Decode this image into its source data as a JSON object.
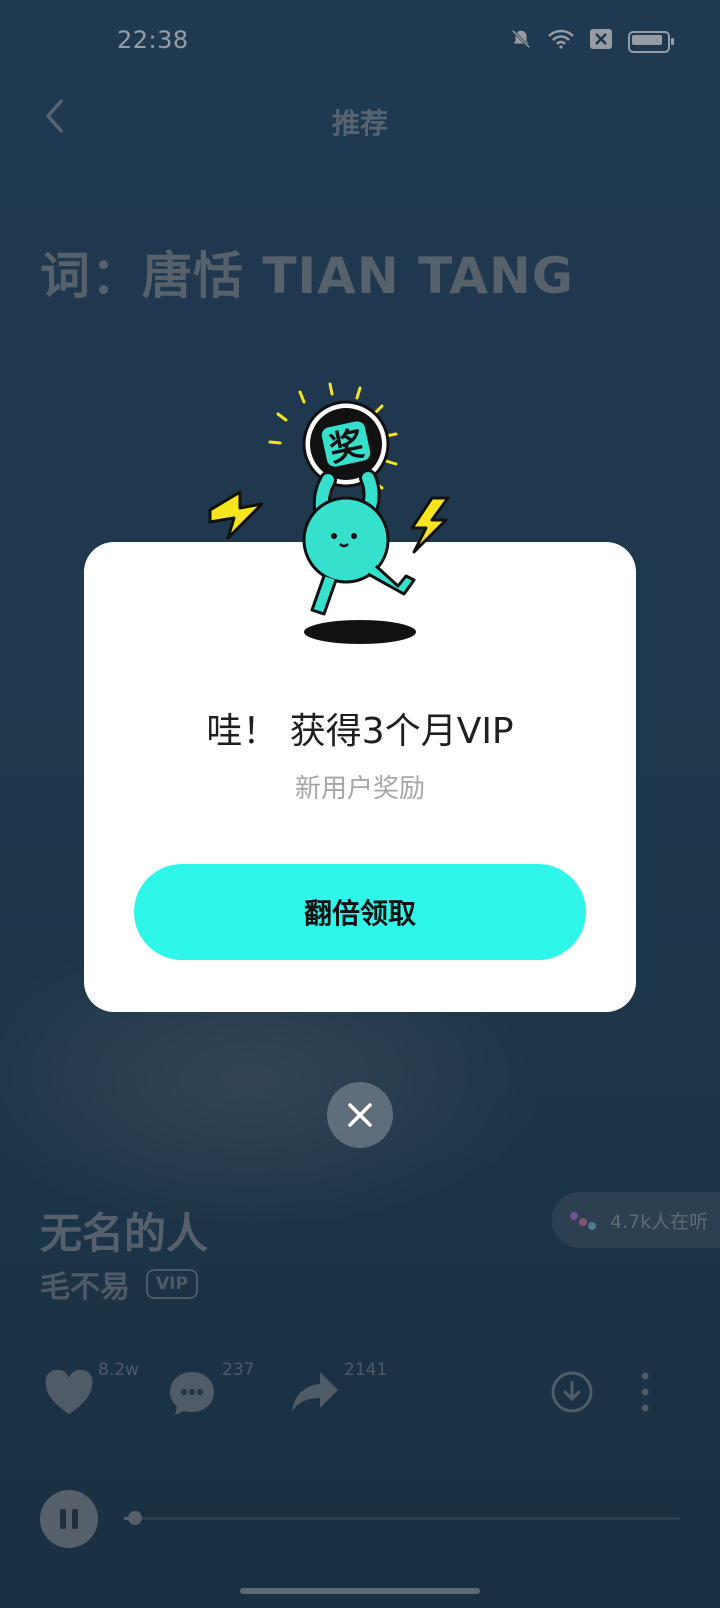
{
  "status": {
    "time": "22:38",
    "icons": [
      "mute-bell-icon",
      "wifi-icon",
      "close-box-icon",
      "battery-icon"
    ]
  },
  "nav": {
    "back_icon": "chevron-left-icon",
    "title": "推荐"
  },
  "lyric": "词：唐恬 TIAN TANG",
  "song": {
    "title": "无名的人",
    "artist": "毛不易",
    "badge": "VIP"
  },
  "listeners": {
    "text": "4.7k人在听"
  },
  "actions": {
    "likes": "8.2w",
    "comments": "237",
    "shares": "2141"
  },
  "player": {
    "progress": 0.02
  },
  "dialog": {
    "title": "哇！ 获得3个月VIP",
    "subtitle": "新用户奖励",
    "button": "翻倍领取",
    "mascot_text": "奖"
  },
  "colors": {
    "accent": "#2ef7e9",
    "mascot": "#35e0cc",
    "lightning": "#f5e51a"
  }
}
